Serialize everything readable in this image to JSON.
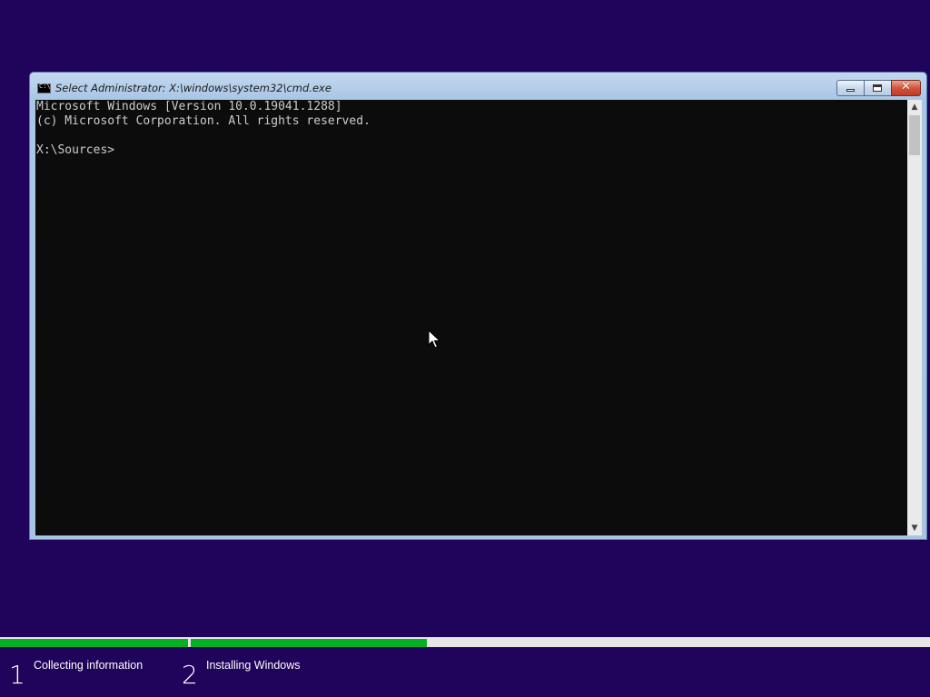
{
  "window": {
    "title": "Select Administrator: X:\\windows\\system32\\cmd.exe"
  },
  "console": {
    "lines": [
      "Microsoft Windows [Version 10.0.19041.1288]",
      "(c) Microsoft Corporation. All rights reserved.",
      "",
      "X:\\Sources>"
    ],
    "colors": {
      "background": "#0c0c0c",
      "text": "#cccccc"
    }
  },
  "setup": {
    "steps": [
      {
        "number": "1",
        "label": "Collecting information",
        "progress": 1.0
      },
      {
        "number": "2",
        "label": "Installing Windows",
        "progress": 0.32
      }
    ],
    "colors": {
      "background": "#20035a",
      "progress_fill": "#06b025",
      "progress_track": "#e6e6e6"
    }
  },
  "icons": {
    "window_icon": "cmd-icon",
    "minimize": "minimize-icon",
    "maximize": "maximize-icon",
    "close": "close-icon",
    "pointer": "mouse-cursor-icon"
  }
}
